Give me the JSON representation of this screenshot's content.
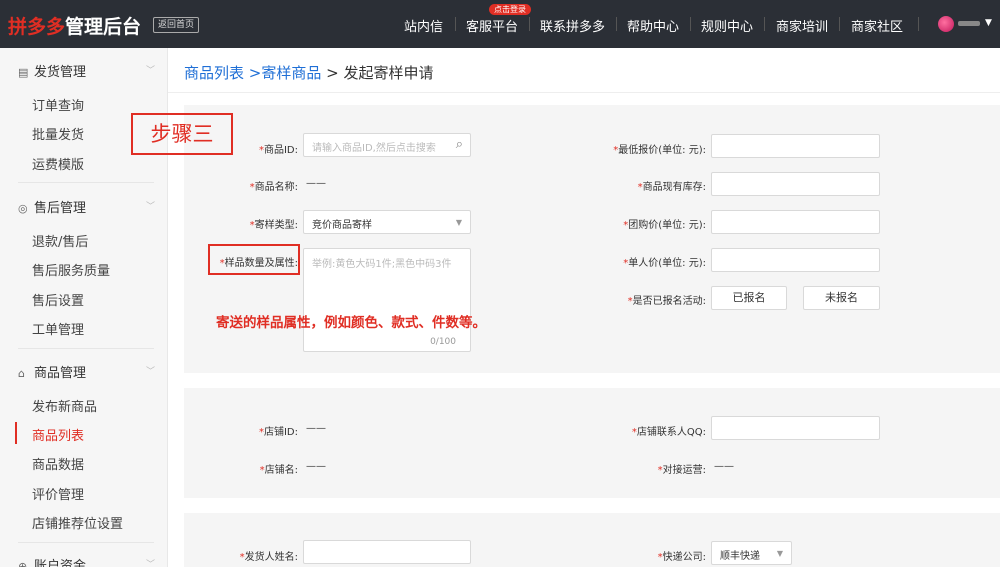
{
  "header": {
    "logo_brand": "拼多多",
    "logo_rest": "管理后台",
    "home_btn": "返回首页",
    "nav": [
      "站内信",
      "客服平台",
      "联系拼多多",
      "帮助中心",
      "规则中心",
      "商家培训",
      "商家社区"
    ],
    "badge": "点击登录"
  },
  "sidebar": {
    "groups": [
      {
        "label": "发货管理",
        "icon": "shipping-icon",
        "items": [
          "订单查询",
          "批量发货",
          "运费模版"
        ]
      },
      {
        "label": "售后管理",
        "icon": "aftersale-icon",
        "items": [
          "退款/售后",
          "售后服务质量",
          "售后设置",
          "工单管理"
        ]
      },
      {
        "label": "商品管理",
        "icon": "goods-icon",
        "items": [
          "发布新商品",
          "商品列表",
          "商品数据",
          "评价管理",
          "店铺推荐位设置"
        ]
      },
      {
        "label": "账户资金",
        "icon": "funds-icon"
      }
    ],
    "active_item": "商品列表"
  },
  "breadcrumb": {
    "l1": "商品列表",
    "sep1": " >",
    "l2": "寄样商品",
    "sep2": " > ",
    "current": "发起寄样申请"
  },
  "annotation": {
    "step": "步骤三",
    "note": "寄送的样品属性，例如颜色、款式、件数等。"
  },
  "form": {
    "req": "*",
    "goods_id_label": "商品ID:",
    "goods_id_placeholder": "请输入商品ID,然后点击搜索",
    "goods_name_label": "商品名称:",
    "goods_name_value": "——",
    "sample_type_label": "寄样类型:",
    "sample_type_value": "竞价商品寄样",
    "sample_attr_label": "样品数量及属性:",
    "sample_attr_placeholder": "举例:黄色大码1件;黑色中码3件",
    "sample_attr_count": "0/100",
    "min_price_label": "最低报价(单位: 元):",
    "stock_label": "商品现有库存:",
    "group_price_label": "团购价(单位: 元):",
    "single_price_label": "单人价(单位: 元):",
    "signed_label": "是否已报名活动:",
    "signed_yes": "已报名",
    "signed_no": "未报名",
    "store_id_label": "店铺ID:",
    "store_id_value": "——",
    "store_name_label": "店铺名:",
    "store_name_value": "——",
    "store_qq_label": "店铺联系人QQ:",
    "operator_label": "对接运营:",
    "operator_value": "——",
    "sender_label": "发货人姓名:",
    "express_label": "快递公司:",
    "express_value": "顺丰快递"
  },
  "colors": {
    "accent": "#e02e24",
    "link": "#1f6fd6",
    "topbar": "#2b2f36"
  }
}
